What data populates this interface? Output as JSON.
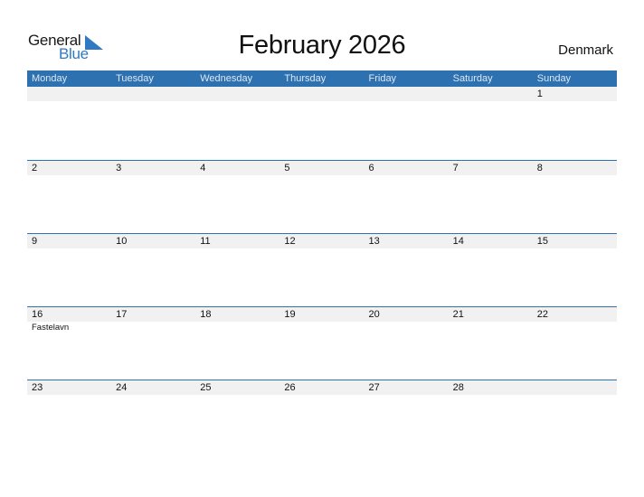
{
  "logo": {
    "word1": "General",
    "word2": "Blue",
    "accent": "#2f7ac0"
  },
  "title": "February 2026",
  "country": "Denmark",
  "colors": {
    "header_bg": "#2e71b1",
    "band_bg": "#f1f1f1"
  },
  "weekdays": [
    "Monday",
    "Tuesday",
    "Wednesday",
    "Thursday",
    "Friday",
    "Saturday",
    "Sunday"
  ],
  "weeks": [
    [
      {
        "d": ""
      },
      {
        "d": ""
      },
      {
        "d": ""
      },
      {
        "d": ""
      },
      {
        "d": ""
      },
      {
        "d": ""
      },
      {
        "d": "1"
      }
    ],
    [
      {
        "d": "2"
      },
      {
        "d": "3"
      },
      {
        "d": "4"
      },
      {
        "d": "5"
      },
      {
        "d": "6"
      },
      {
        "d": "7"
      },
      {
        "d": "8"
      }
    ],
    [
      {
        "d": "9"
      },
      {
        "d": "10"
      },
      {
        "d": "11"
      },
      {
        "d": "12"
      },
      {
        "d": "13"
      },
      {
        "d": "14"
      },
      {
        "d": "15"
      }
    ],
    [
      {
        "d": "16",
        "h": "Fastelavn"
      },
      {
        "d": "17"
      },
      {
        "d": "18"
      },
      {
        "d": "19"
      },
      {
        "d": "20"
      },
      {
        "d": "21"
      },
      {
        "d": "22"
      }
    ],
    [
      {
        "d": "23"
      },
      {
        "d": "24"
      },
      {
        "d": "25"
      },
      {
        "d": "26"
      },
      {
        "d": "27"
      },
      {
        "d": "28"
      },
      {
        "d": ""
      }
    ]
  ]
}
